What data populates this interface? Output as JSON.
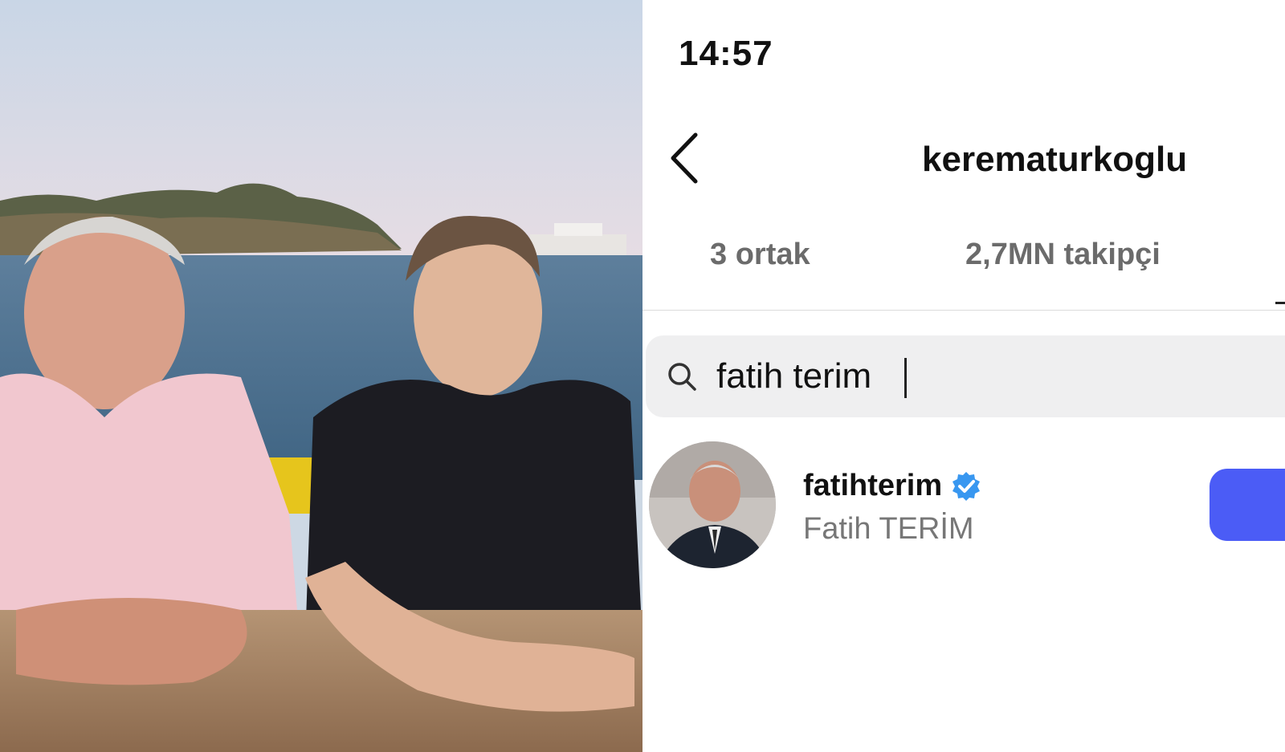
{
  "status_bar": {
    "time": "14:57"
  },
  "header": {
    "back_icon": "chevron-left-icon",
    "profile_username": "kerematurkoglu"
  },
  "tabs": [
    {
      "label": "3 ortak"
    },
    {
      "label": "2,7MN takipçi"
    }
  ],
  "search": {
    "icon": "search-icon",
    "value": "fatih terim"
  },
  "results": [
    {
      "username": "fatihterim",
      "full_name": "Fatih TERİM",
      "verified": true,
      "verified_icon": "verified-badge-icon",
      "avatar": "profile-photo"
    }
  ],
  "colors": {
    "follow_button": "#4b5cf6",
    "verified_badge": "#3897f0",
    "search_bg": "#efeff0"
  }
}
